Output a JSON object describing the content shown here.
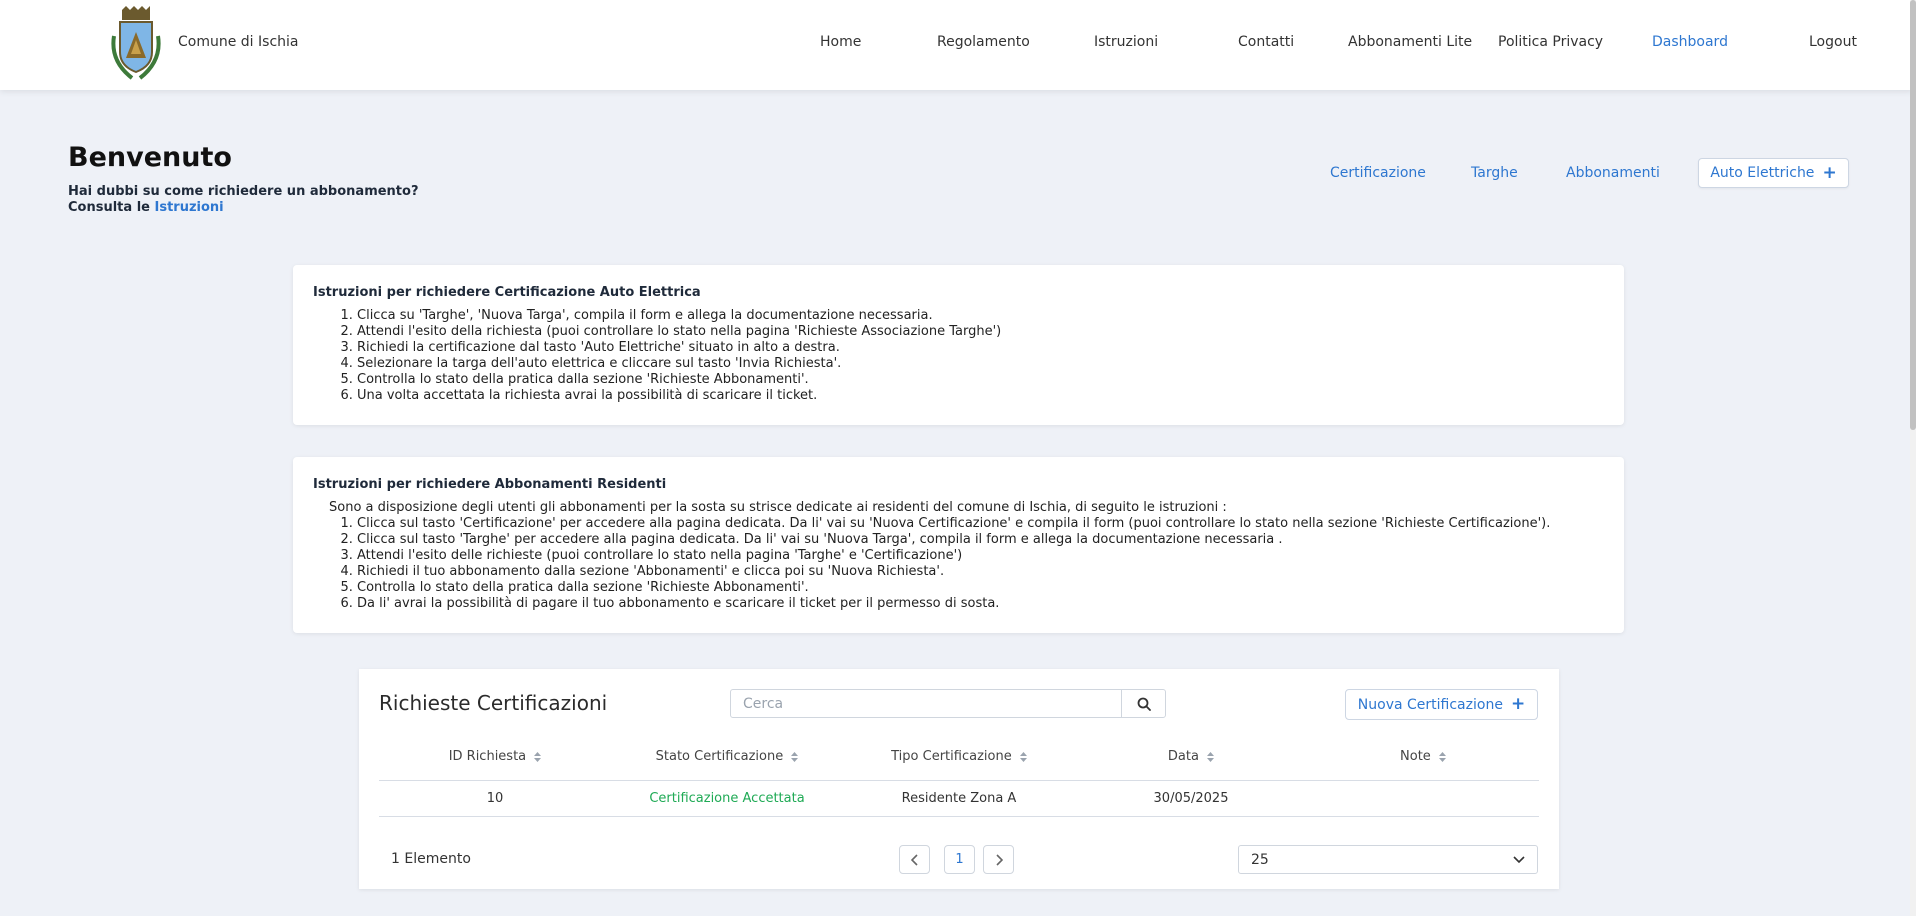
{
  "header": {
    "brand": "Comune di Ischia",
    "nav": [
      {
        "label": "Home"
      },
      {
        "label": "Regolamento"
      },
      {
        "label": "Istruzioni"
      },
      {
        "label": "Contatti"
      },
      {
        "label": "Abbonamenti Lite"
      },
      {
        "label": "Politica Privacy"
      },
      {
        "label": "Dashboard",
        "active": true
      },
      {
        "label": "Logout"
      }
    ]
  },
  "welcome": {
    "title": "Benvenuto",
    "line1": "Hai dubbi su come richiedere un abbonamento?",
    "line2_prefix": "Consulta le",
    "line2_link": "Istruzioni"
  },
  "actions": {
    "certificazione": "Certificazione",
    "targhe": "Targhe",
    "abbonamenti": "Abbonamenti",
    "auto_elettriche": "Auto Elettriche"
  },
  "card1": {
    "title": "Istruzioni per richiedere Certificazione Auto Elettrica",
    "steps": [
      "Clicca su 'Targhe', 'Nuova Targa', compila il form e allega la documentazione necessaria.",
      "Attendi l'esito della richiesta (puoi controllare lo stato nella pagina 'Richieste Associazione Targhe')",
      "Richiedi la certificazione dal tasto 'Auto Elettriche' situato in alto a destra.",
      "Selezionare la targa dell'auto elettrica e cliccare sul tasto 'Invia Richiesta'.",
      "Controlla lo stato della pratica dalla sezione 'Richieste Abbonamenti'.",
      "Una volta accettata la richiesta avrai la possibilità di scaricare il ticket."
    ]
  },
  "card2": {
    "title": "Istruzioni per richiedere Abbonamenti Residenti",
    "intro": "Sono a disposizione degli utenti gli abbonamenti per la sosta su strisce dedicate ai residenti del comune di Ischia, di seguito le istruzioni :",
    "steps": [
      "Clicca sul tasto 'Certificazione' per accedere alla pagina dedicata. Da li' vai su 'Nuova Certificazione' e compila il form (puoi controllare lo stato nella sezione 'Richieste Certificazione').",
      "Clicca sul tasto 'Targhe' per accedere alla pagina dedicata. Da li' vai su 'Nuova Targa', compila il form e allega la documentazione necessaria .",
      "Attendi l'esito delle richieste (puoi controllare lo stato nella pagina 'Targhe' e 'Certificazione')",
      "Richiedi il tuo abbonamento dalla sezione 'Abbonamenti' e clicca poi su 'Nuova Richiesta'.",
      "Controlla lo stato della pratica dalla sezione 'Richieste Abbonamenti'.",
      "Da li' avrai la possibilità di pagare il tuo abbonamento e scaricare il ticket per il permesso di sosta."
    ]
  },
  "table": {
    "title": "Richieste Certificazioni",
    "search_placeholder": "Cerca",
    "new_button": "Nuova Certificazione",
    "columns": [
      "ID Richiesta",
      "Stato Certificazione",
      "Tipo Certificazione",
      "Data",
      "Note"
    ],
    "rows": [
      {
        "id": "10",
        "stato": "Certificazione Accettata",
        "tipo": "Residente Zona A",
        "data": "30/05/2025",
        "note": ""
      }
    ],
    "count": "1 Elemento",
    "page": "1",
    "page_size": "25"
  },
  "colors": {
    "accent": "#2e77d0",
    "success": "#1faa55",
    "background": "#eef1f7"
  }
}
